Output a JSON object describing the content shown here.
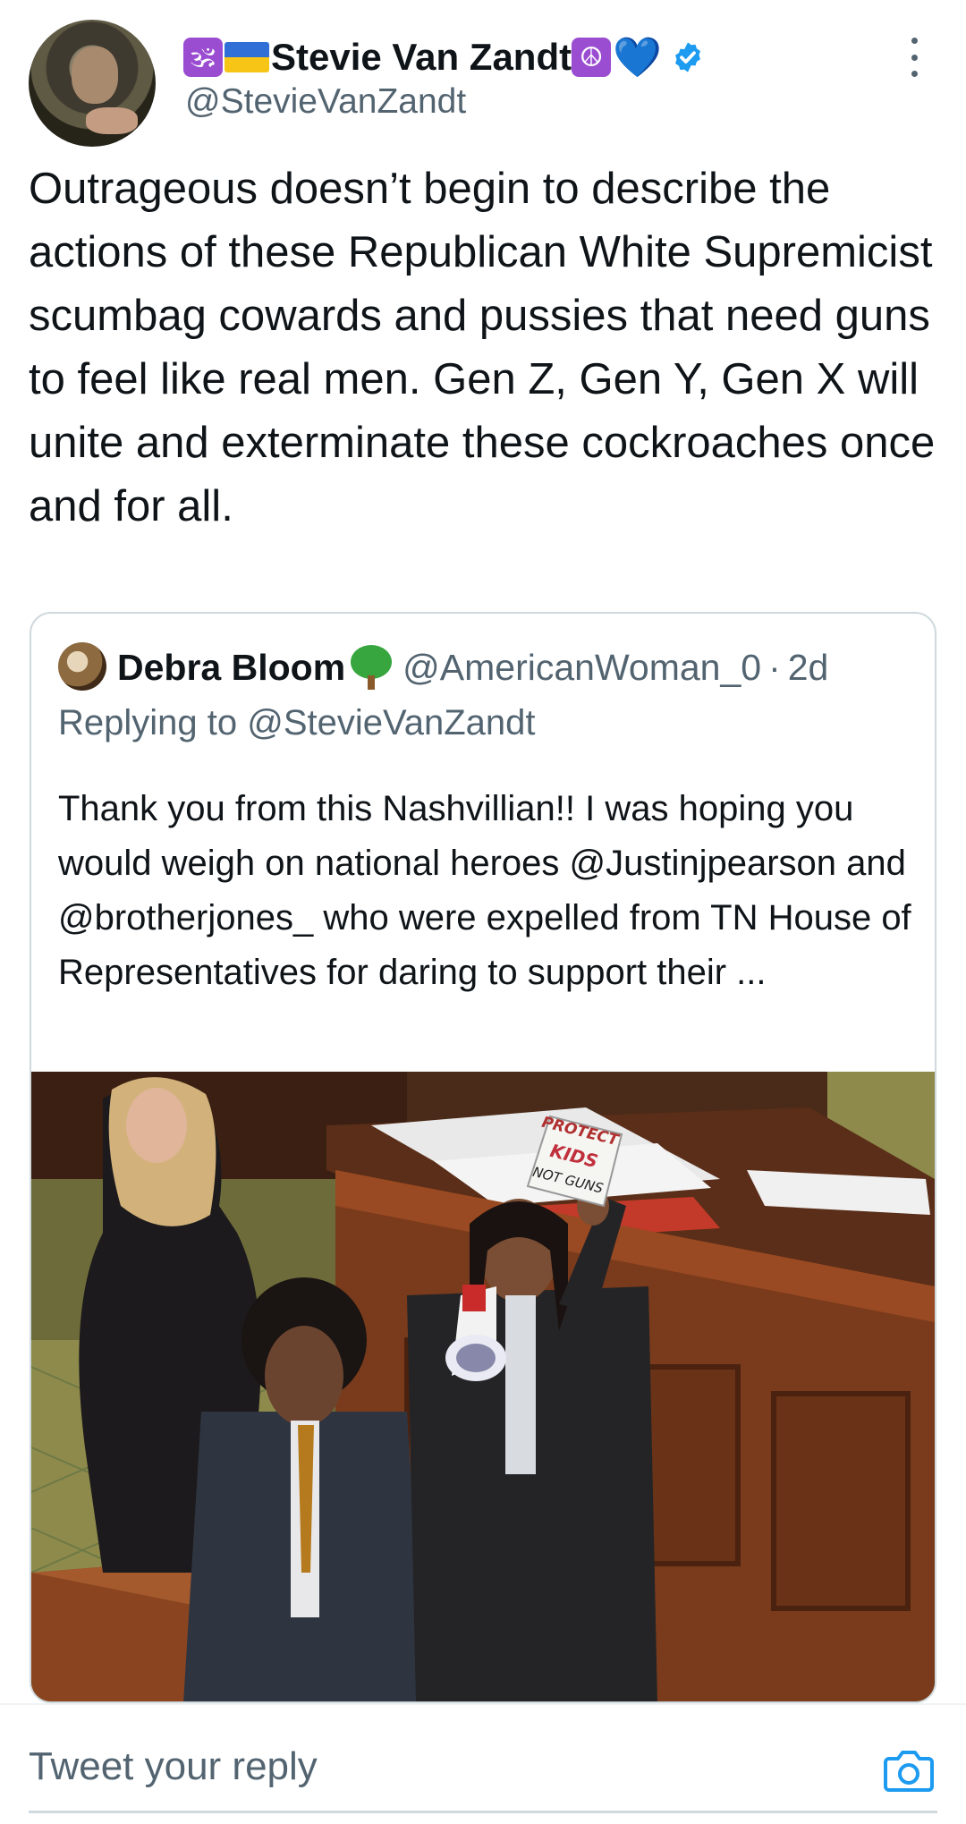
{
  "tweet": {
    "author": {
      "prefix_emoji": "🕉",
      "flag_emoji": "🇺🇦",
      "name": "Stevie Van Zandt",
      "suffix_emoji": "☮",
      "heart_emoji": "💙",
      "handle": "@StevieVanZandt",
      "verified": true
    },
    "text": "Outrageous doesn’t begin to describe the actions of these Republican White Supremicist scumbag cowards and pussies that need guns to feel like real men. Gen Z, Gen Y, Gen X will unite and exterminate these cockroaches once and for all."
  },
  "quote": {
    "name": "Debra Bloom",
    "name_emoji": "🌳",
    "handle": "@AmericanWoman_0",
    "separator": "·",
    "time": "2d",
    "replying_prefix": "Replying to",
    "replying_to": "@StevieVanZandt",
    "text": "Thank you from this Nashvillian!! I was hoping you would weigh on national heroes @Justinjpearson and @brotherjones_  who were expelled from TN House of Representatives for daring to support their ...",
    "image": {
      "sign_lines": [
        "PROTECT",
        "KIDS",
        "NOT GUNS"
      ]
    }
  },
  "reply": {
    "placeholder": "Tweet your reply"
  },
  "colors": {
    "text_primary": "#0f1419",
    "text_secondary": "#536471",
    "verified_blue": "#1d9bf0",
    "border": "#cfd9de"
  },
  "icons": [
    "more-icon",
    "verified-badge-icon",
    "camera-icon"
  ]
}
